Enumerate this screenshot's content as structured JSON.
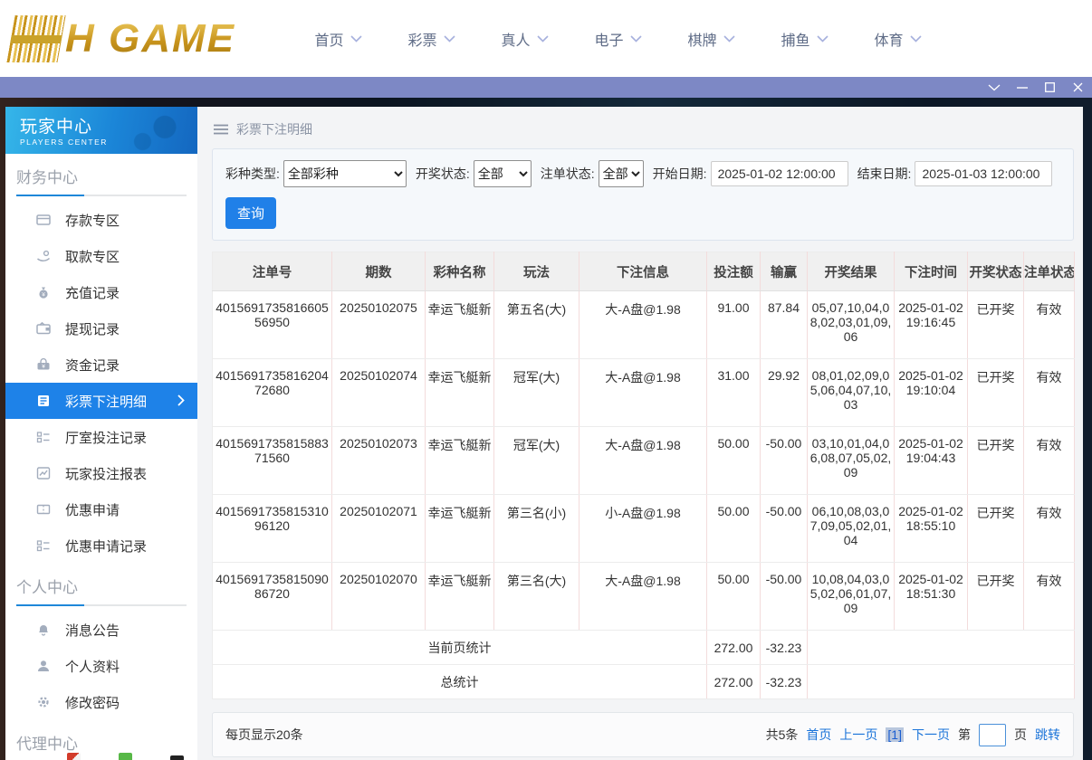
{
  "topnav": {
    "logo": {
      "mark": "H",
      "text": "H GAME"
    },
    "items": [
      "首页",
      "彩票",
      "真人",
      "电子",
      "棋牌",
      "捕鱼",
      "体育"
    ]
  },
  "titlebar": {
    "controls": [
      "chevron-down",
      "minimize",
      "maximize",
      "close"
    ]
  },
  "sidebar": {
    "header": {
      "title": "玩家中心",
      "subtitle": "PLAYERS CENTER"
    },
    "sections": [
      {
        "title": "财务中心",
        "items": [
          {
            "label": "存款专区",
            "icon": "deposit-card-icon"
          },
          {
            "label": "取款专区",
            "icon": "withdraw-hand-icon"
          },
          {
            "label": "充值记录",
            "icon": "recharge-bag-icon"
          },
          {
            "label": "提现记录",
            "icon": "withdraw-record-icon"
          },
          {
            "label": "资金记录",
            "icon": "funds-record-icon"
          },
          {
            "label": "彩票下注明细",
            "icon": "lottery-bet-detail-icon",
            "active": true
          },
          {
            "label": "厅室投注记录",
            "icon": "hall-bet-record-icon"
          },
          {
            "label": "玩家投注报表",
            "icon": "player-report-icon"
          },
          {
            "label": "优惠申请",
            "icon": "promo-apply-icon"
          },
          {
            "label": "优惠申请记录",
            "icon": "promo-record-icon"
          }
        ]
      },
      {
        "title": "个人中心",
        "items": [
          {
            "label": "消息公告",
            "icon": "bell-icon"
          },
          {
            "label": "个人资料",
            "icon": "person-icon"
          },
          {
            "label": "修改密码",
            "icon": "gear-icon"
          }
        ]
      },
      {
        "title": "代理中心",
        "items": []
      }
    ]
  },
  "breadcrumb": {
    "title": "彩票下注明细"
  },
  "filters": {
    "lottery_type": {
      "label": "彩种类型:",
      "value": "全部彩种"
    },
    "draw_status": {
      "label": "开奖状态:",
      "value": "全部"
    },
    "bet_status": {
      "label": "注单状态:",
      "value": "全部"
    },
    "start_date": {
      "label": "开始日期:",
      "value": "2025-01-02 12:00:00"
    },
    "end_date": {
      "label": "结束日期:",
      "value": "2025-01-03 12:00:00"
    },
    "search_label": "查询"
  },
  "table": {
    "headers": [
      "注单号",
      "期数",
      "彩种名称",
      "玩法",
      "下注信息",
      "投注额",
      "输赢",
      "开奖结果",
      "下注时间",
      "开奖状态",
      "注单状态"
    ],
    "rows": [
      [
        "401569173581660556950",
        "20250102075",
        "幸运飞艇新",
        "第五名(大)",
        "大-A盘@1.98",
        "91.00",
        "87.84",
        "05,07,10,04,08,02,03,01,09,06",
        "2025-01-02 19:16:45",
        "已开奖",
        "有效"
      ],
      [
        "401569173581620472680",
        "20250102074",
        "幸运飞艇新",
        "冠军(大)",
        "大-A盘@1.98",
        "31.00",
        "29.92",
        "08,01,02,09,05,06,04,07,10,03",
        "2025-01-02 19:10:04",
        "已开奖",
        "有效"
      ],
      [
        "401569173581588371560",
        "20250102073",
        "幸运飞艇新",
        "冠军(大)",
        "大-A盘@1.98",
        "50.00",
        "-50.00",
        "03,10,01,04,06,08,07,05,02,09",
        "2025-01-02 19:04:43",
        "已开奖",
        "有效"
      ],
      [
        "401569173581531096120",
        "20250102071",
        "幸运飞艇新",
        "第三名(小)",
        "小-A盘@1.98",
        "50.00",
        "-50.00",
        "06,10,08,03,07,09,05,02,01,04",
        "2025-01-02 18:55:10",
        "已开奖",
        "有效"
      ],
      [
        "401569173581509086720",
        "20250102070",
        "幸运飞艇新",
        "第三名(大)",
        "大-A盘@1.98",
        "50.00",
        "-50.00",
        "10,08,04,03,05,02,06,01,07,09",
        "2025-01-02 18:51:30",
        "已开奖",
        "有效"
      ]
    ],
    "summary": [
      {
        "label": "当前页统计",
        "bet_total": "272.00",
        "winloss_total": "-32.23"
      },
      {
        "label": "总统计",
        "bet_total": "272.00",
        "winloss_total": "-32.23"
      }
    ]
  },
  "pagination": {
    "page_size_text": "每页显示20条",
    "total_text": "共5条",
    "first_label": "首页",
    "prev_label": "上一页",
    "current_page": "[1]",
    "next_label": "下一页",
    "jump_prefix": "第",
    "jump_value": "",
    "jump_suffix": "页",
    "jump_label": "跳转"
  },
  "colors": {
    "titlebar": "#7d88c5",
    "accent_blue": "#1e82e8",
    "link_blue": "#1a73d9",
    "logo_gold": "#c8941c",
    "table_divider_pink": "#f3dcdc"
  }
}
